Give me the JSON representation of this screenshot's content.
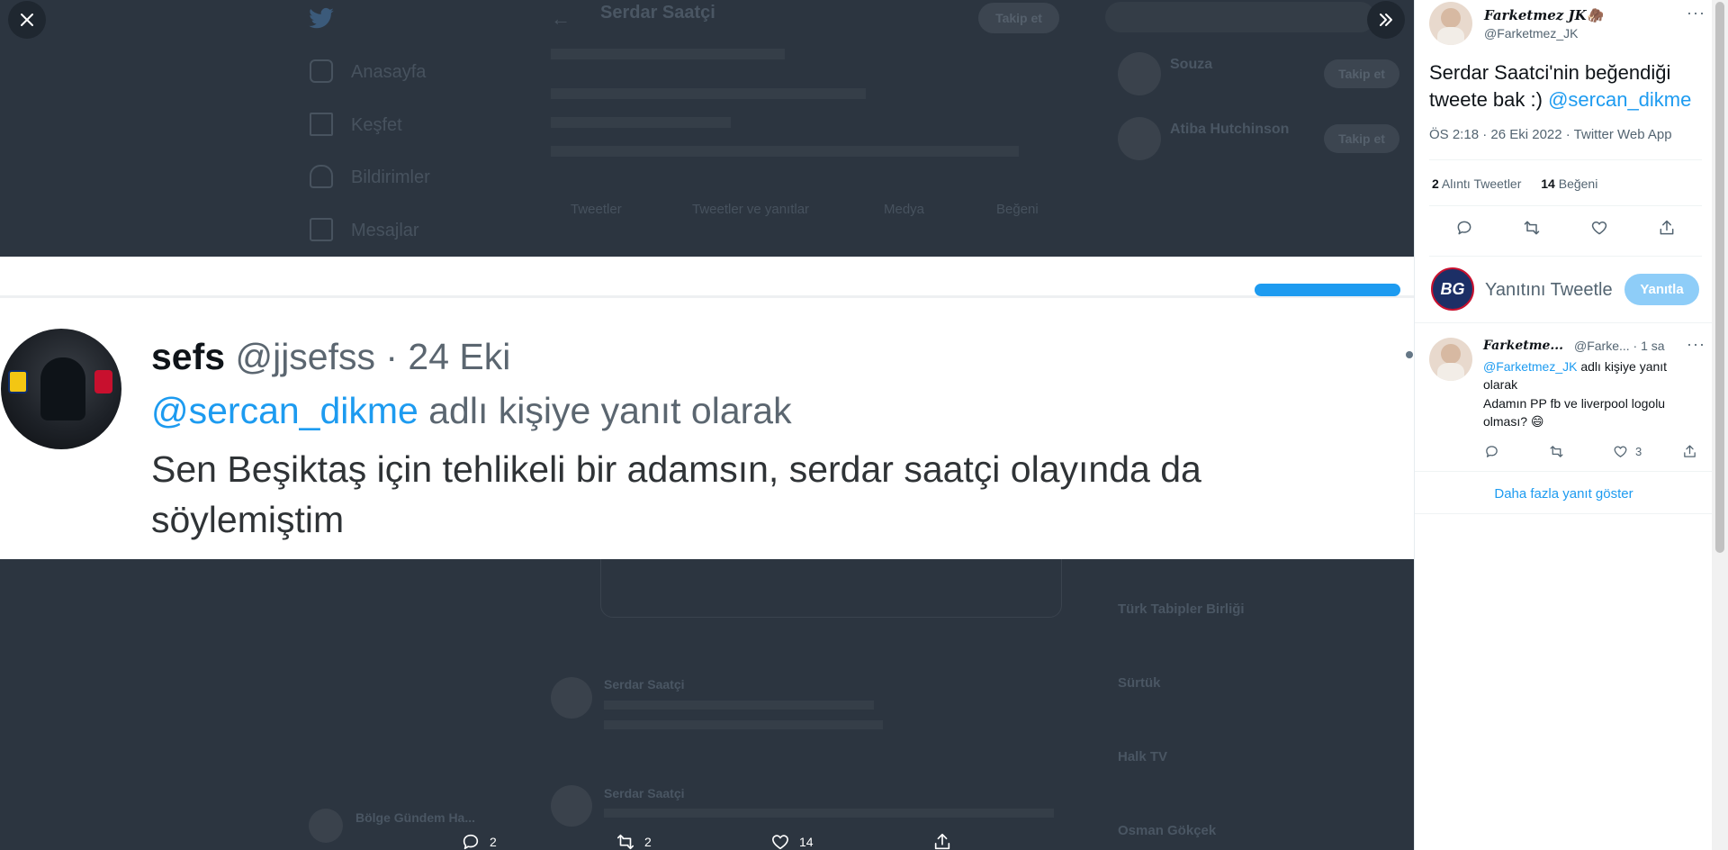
{
  "overlay": {
    "close_icon": "close-icon",
    "expand_icon": "chevrons-right-icon",
    "bottom_stats": [
      {
        "icon": "reply-icon",
        "count": "2"
      },
      {
        "icon": "retweet-icon",
        "count": "2"
      },
      {
        "icon": "heart-icon",
        "count": "14"
      },
      {
        "icon": "share-icon",
        "count": ""
      }
    ]
  },
  "media": {
    "name": "sefs",
    "handle_date": "@jjsefss · 24 Eki",
    "reply_mention": "@sercan_dikme",
    "reply_suffix": " adlı kişiye yanıt olarak",
    "body": "Sen Beşiktaş için tehlikeli bir adamsın, serdar saatçi olayında da söylemiştim"
  },
  "background": {
    "profile_name": "Serdar Saatçi",
    "follow_button": "Takip et",
    "nav": [
      "Anasayfa",
      "Keşfet",
      "Bildirimler",
      "Mesajlar"
    ],
    "tabs": [
      "Tweetler",
      "Tweetler ve yanıtlar",
      "Medya",
      "Beğeni"
    ],
    "suggestions": [
      {
        "name": "Souza",
        "button": "Takip et"
      },
      {
        "name": "Atiba Hutchinson",
        "button": "Takip et"
      }
    ],
    "trends": [
      "Türk Tabipler Birliği",
      "Sürtük",
      "Halk TV",
      "Osman Gökçek"
    ],
    "account_name": "Bölge Gündem Ha..."
  },
  "panel": {
    "tweet": {
      "name": "Farketmez JK🦣",
      "handle": "@Farketmez_JK",
      "text_before": "Serdar Saatci'nin beğendiği tweete bak :) ",
      "text_mention": "@sercan_dikme",
      "meta": "ÖS 2:18 · 26 Eki 2022 · Twitter Web App",
      "quote_count": "2",
      "quote_label": "Alıntı Tweetler",
      "like_count": "14",
      "like_label": "Beğeni"
    },
    "compose": {
      "placeholder": "Yanıtını Tweetle",
      "button": "Yanıtla",
      "logo": "BG"
    },
    "reply": {
      "name": "Farketme...",
      "handle_time": "@Farke... · 1 sa",
      "reply_to_mention": "@Farketmez_JK",
      "reply_to_suffix": " adlı kişiye yanıt olarak",
      "text": "Adamın PP fb ve liverpool logolu olması? 😄",
      "like_count": "3"
    },
    "show_more": "Daha fazla yanıt göster"
  }
}
